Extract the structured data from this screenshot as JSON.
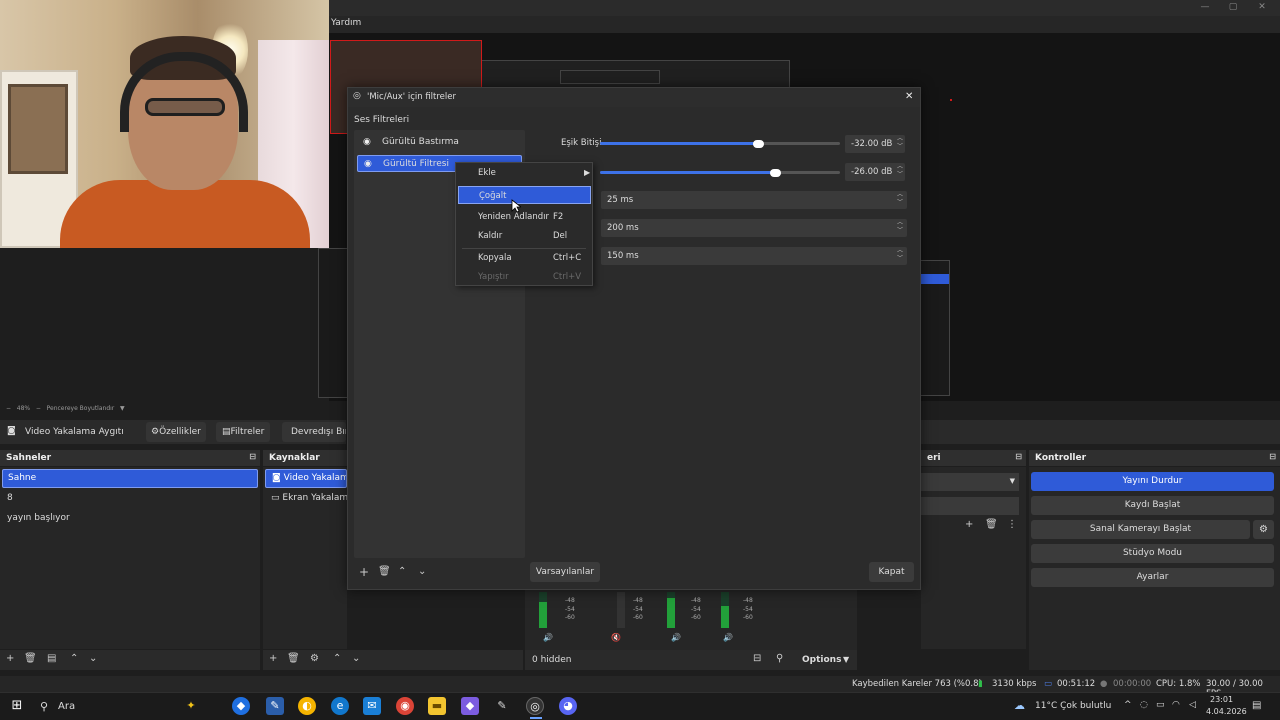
{
  "menubar": {
    "help": "Yardım"
  },
  "props_bar": {
    "source": "Video Yakalama Aygıtı",
    "properties": "Özellikler",
    "filters": "Filtreler",
    "deactivate": "Devredışı Bıra"
  },
  "preview_footer": {
    "zoom": "48%",
    "fit": "Pencereye Boyutlandır"
  },
  "scenes": {
    "title": "Sahneler",
    "items": [
      "Sahne",
      "8",
      "yayın başlıyor"
    ]
  },
  "sources": {
    "title": "Kaynaklar",
    "items": [
      "Video Yakalama",
      "Ekran Yakalama"
    ]
  },
  "transitions": {
    "title": "eri"
  },
  "controls": {
    "title": "Kontroller",
    "buttons": [
      "Yayını Durdur",
      "Kaydı Başlat",
      "Sanal Kamerayı Başlat",
      "Stüdyo Modu",
      "Ayarlar"
    ],
    "accent": "#2f5bd8"
  },
  "mixer": {
    "hidden": "0 hidden",
    "options": "Options",
    "ticks": [
      "-48",
      "-54",
      "-60"
    ]
  },
  "dialog": {
    "title": "'Mic/Aux' için filtreler",
    "section": "Ses Filtreleri",
    "filters": [
      "Gürültü Bastırma",
      "Gürültü Filtresi"
    ],
    "params": {
      "close_threshold_label": "Eşik Bitişi",
      "close_threshold_value": "-32.00 dB",
      "close_threshold_level": 0.66,
      "open_threshold_value": "-26.00 dB",
      "open_threshold_level": 0.73,
      "attack": "25 ms",
      "hold": "200 ms",
      "release": "150 ms"
    },
    "defaults_button": "Varsayılanlar",
    "close_button": "Kapat"
  },
  "context_menu": {
    "items": [
      {
        "label": "Ekle",
        "shortcut": ""
      },
      {
        "label": "Çoğalt",
        "shortcut": ""
      },
      {
        "label": "Yeniden Adlandır",
        "shortcut": "F2"
      },
      {
        "label": "Kaldır",
        "shortcut": "Del"
      },
      {
        "label": "Kopyala",
        "shortcut": "Ctrl+C"
      },
      {
        "label": "Yapıştır",
        "shortcut": "Ctrl+V"
      }
    ]
  },
  "statusbar": {
    "dropped": "Kaybedilen Kareler 763 (%0.8)",
    "bitrate": "3130 kbps",
    "stream_time": "00:51:12",
    "rec_time": "00:00:00",
    "cpu": "CPU: 1.8%",
    "fps": "30.00 / 30.00 FPS"
  },
  "taskbar": {
    "search": "Ara",
    "weather": "11°C  Çok bulutlu",
    "time": "23:01",
    "date": "4.04.2026"
  }
}
